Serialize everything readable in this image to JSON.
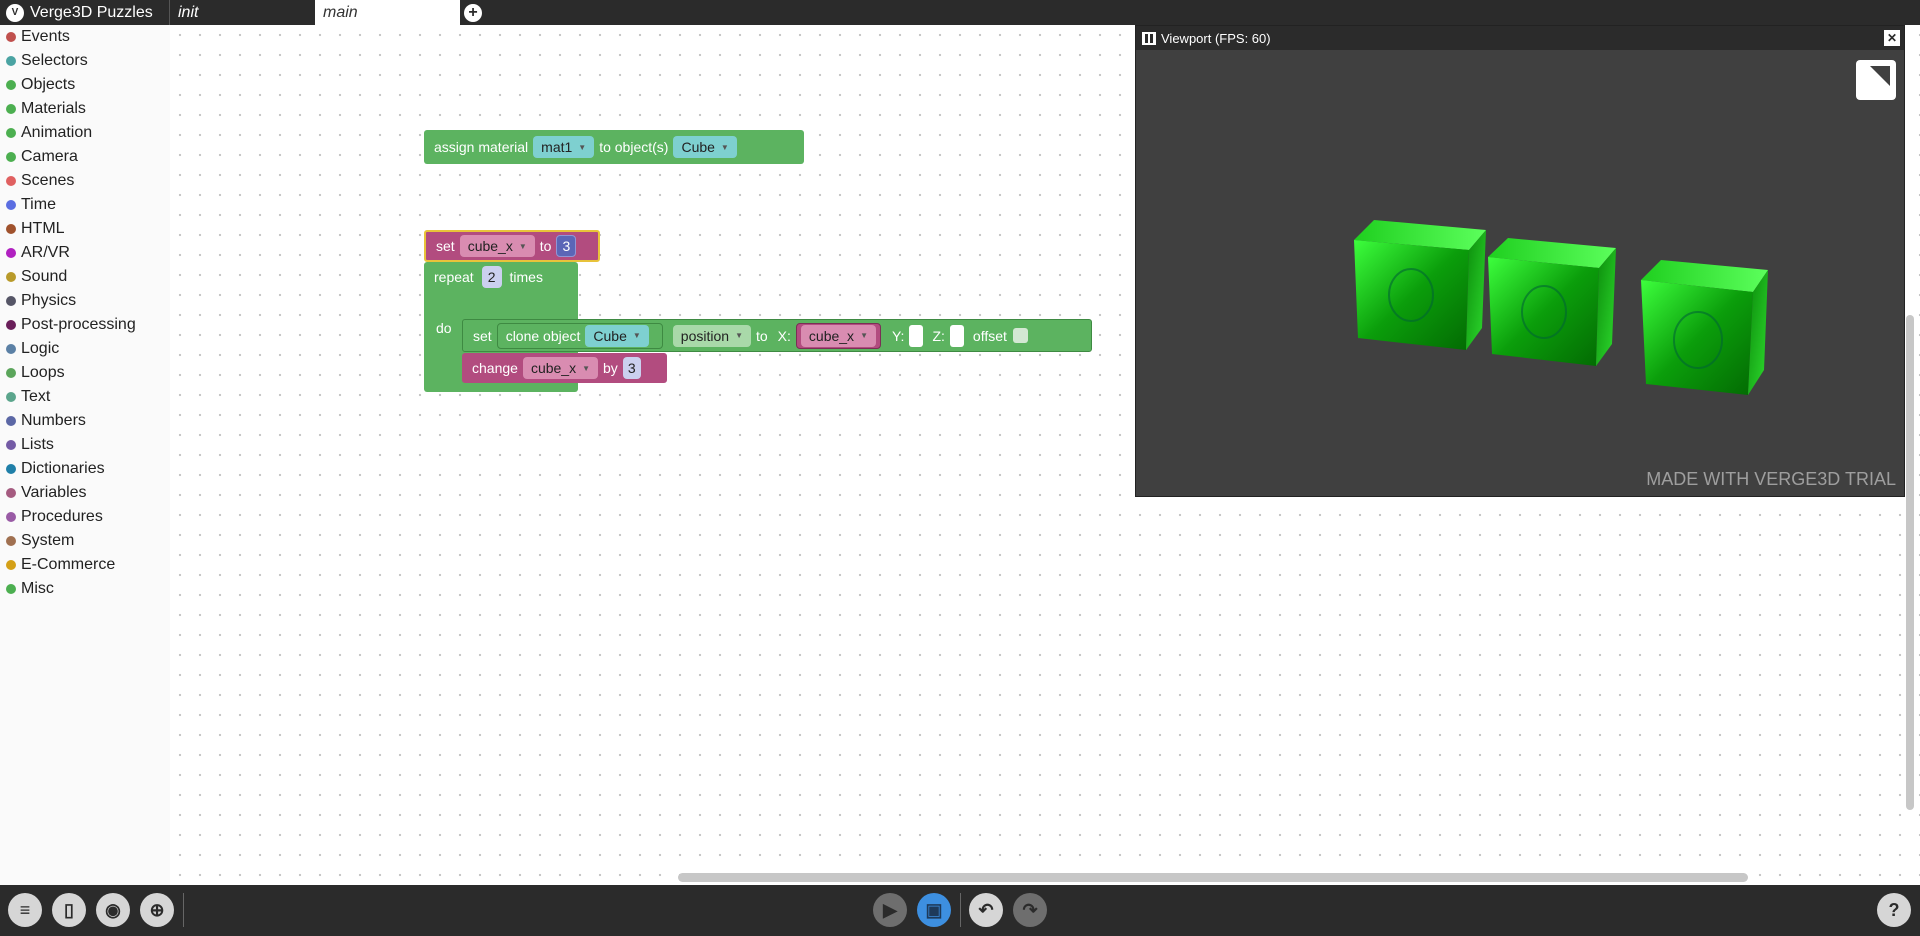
{
  "app": {
    "title": "Verge3D Puzzles",
    "logo_glyph": "V"
  },
  "tabs": [
    {
      "label": "init",
      "active": false
    },
    {
      "label": "main",
      "active": true
    }
  ],
  "add_tab_glyph": "+",
  "categories": [
    {
      "label": "Events",
      "color": "#c0504d"
    },
    {
      "label": "Selectors",
      "color": "#4aa3a2"
    },
    {
      "label": "Objects",
      "color": "#4caf50"
    },
    {
      "label": "Materials",
      "color": "#4caf50"
    },
    {
      "label": "Animation",
      "color": "#4caf50"
    },
    {
      "label": "Camera",
      "color": "#4caf50"
    },
    {
      "label": "Scenes",
      "color": "#e06060"
    },
    {
      "label": "Time",
      "color": "#5b6ee1"
    },
    {
      "label": "HTML",
      "color": "#a0522d"
    },
    {
      "label": "AR/VR",
      "color": "#b020c0"
    },
    {
      "label": "Sound",
      "color": "#b89a2a"
    },
    {
      "label": "Physics",
      "color": "#555566"
    },
    {
      "label": "Post-processing",
      "color": "#6a1f5a"
    },
    {
      "label": "Logic",
      "color": "#5b80a5"
    },
    {
      "label": "Loops",
      "color": "#5ba55b"
    },
    {
      "label": "Text",
      "color": "#5ba58c"
    },
    {
      "label": "Numbers",
      "color": "#5b67a5"
    },
    {
      "label": "Lists",
      "color": "#745ba5"
    },
    {
      "label": "Dictionaries",
      "color": "#1f7fa8"
    },
    {
      "label": "Variables",
      "color": "#a55b80"
    },
    {
      "label": "Procedures",
      "color": "#995ba5"
    },
    {
      "label": "System",
      "color": "#a07050"
    },
    {
      "label": "E-Commerce",
      "color": "#d4a017"
    },
    {
      "label": "Misc",
      "color": "#4caf50"
    }
  ],
  "blocks": {
    "assign_material": {
      "label": "assign material",
      "material": "mat1",
      "to_label": "to object(s)",
      "object": "Cube"
    },
    "set_var": {
      "label": "set",
      "var": "cube_x",
      "to_label": "to",
      "value": "3"
    },
    "repeat": {
      "label": "repeat",
      "count": "2",
      "times_label": "times",
      "do_label": "do"
    },
    "set_clone": {
      "set_label": "set",
      "clone_label": "clone object",
      "object": "Cube",
      "property": "position",
      "to_label": "to",
      "x_label": "X:",
      "x_var": "cube_x",
      "y_label": "Y:",
      "z_label": "Z:",
      "offset_label": "offset"
    },
    "change": {
      "label": "change",
      "var": "cube_x",
      "by_label": "by",
      "value": "3"
    }
  },
  "viewport": {
    "title": "Viewport (FPS: 60)",
    "close_glyph": "✕",
    "watermark": "MADE WITH VERGE3D TRIAL"
  },
  "toolbar": {
    "play_glyph": "▶",
    "undo_glyph": "↶",
    "redo_glyph": "↷",
    "help_glyph": "?"
  }
}
